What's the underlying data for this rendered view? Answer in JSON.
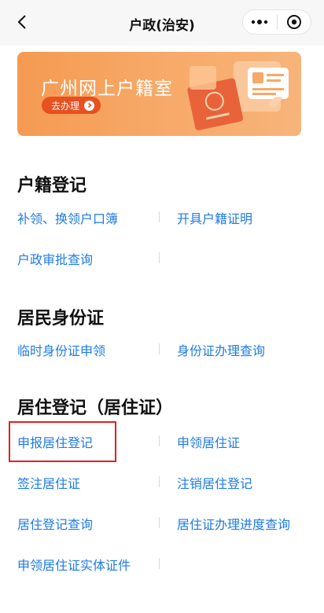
{
  "nav": {
    "title": "户政(治安)",
    "back_icon": "chevron-left-icon",
    "more_icon": "more-dots-icon",
    "close_icon": "target-circle-icon"
  },
  "banner": {
    "title": "广州网上户籍室",
    "button_label": "去办理",
    "bg_color": "#f7a968",
    "button_color": "#e8501f"
  },
  "sections": [
    {
      "title": "户籍登记",
      "links": [
        "补领、换领户口簿",
        "开具户籍证明",
        "户政审批查询"
      ]
    },
    {
      "title": "居民身份证",
      "links": [
        "临时身份证申领",
        "身份证办理查询"
      ]
    },
    {
      "title": "居住登记（居住证）",
      "links": [
        "申报居住登记",
        "申领居住证",
        "签注居住证",
        "注销居住登记",
        "居住登记查询",
        "居住证办理进度查询",
        "申领居住证实体证件"
      ]
    }
  ],
  "colors": {
    "link": "#1e7be6",
    "highlight": "#e02020"
  }
}
